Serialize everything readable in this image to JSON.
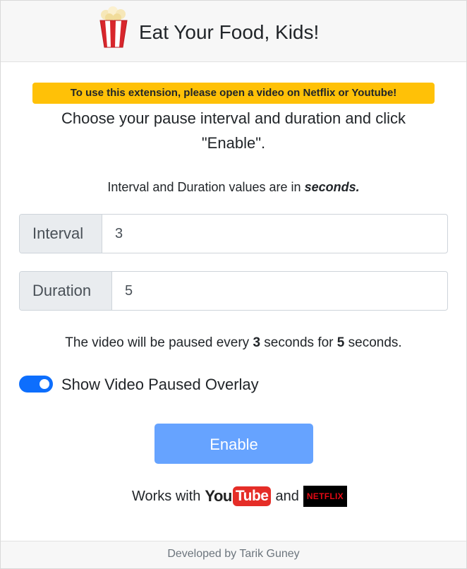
{
  "header": {
    "title": "Eat Your Food, Kids!",
    "logo_icon": "popcorn-icon"
  },
  "warning": "To use this extension, please open a video on Netflix or Youtube!",
  "instructions": "Choose your pause interval and duration and click \"Enable\".",
  "note": {
    "prefix": "Interval and Duration values are in ",
    "emphasis": "seconds."
  },
  "interval": {
    "label": "Interval",
    "value": "3"
  },
  "duration": {
    "label": "Duration",
    "value": "5"
  },
  "summary": {
    "part1": "The video will be paused every ",
    "interval": "3",
    "part2": " seconds for ",
    "duration": "5",
    "part3": " seconds."
  },
  "overlay_toggle": {
    "label": "Show Video Paused Overlay",
    "checked": true
  },
  "enable_button": "Enable",
  "works_with": {
    "prefix": "Works with",
    "youtube_you": "You",
    "youtube_tube": "Tube",
    "and": "and",
    "netflix": "NETFLIX"
  },
  "footer": "Developed by Tarik Guney",
  "colors": {
    "accent": "#0d6efd",
    "button": "#66a3ff",
    "warning": "#ffc107",
    "youtube_red": "#e52d27",
    "netflix_red": "#e50914"
  }
}
